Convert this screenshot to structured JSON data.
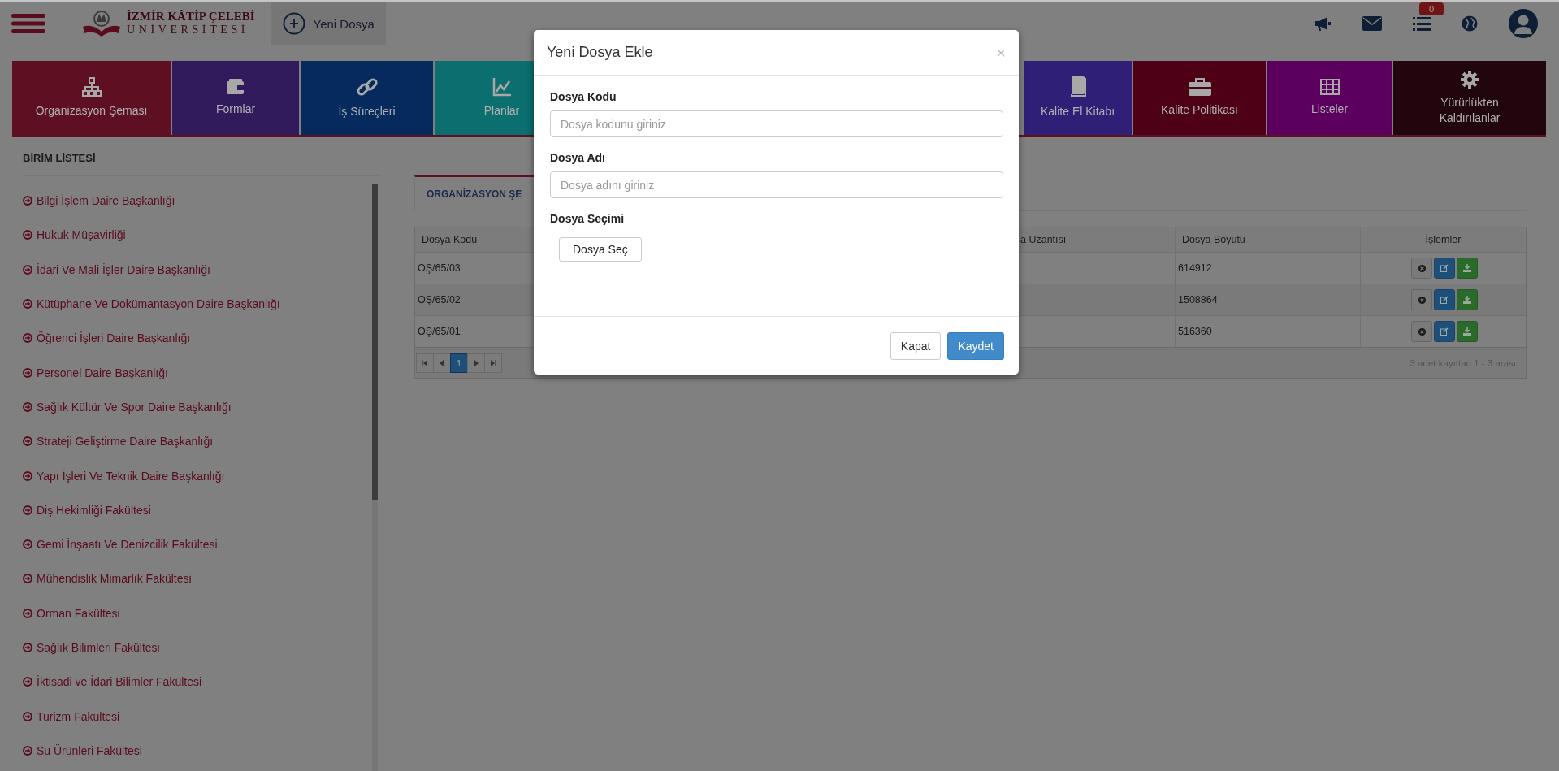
{
  "header": {
    "logo": {
      "line1": "İZMİR KÂTİP ÇELEBİ",
      "line2": "ÜNİVERSİTESİ"
    },
    "new_button": "Yeni Dosya",
    "notification_count": "0"
  },
  "tiles": [
    {
      "label": "Organizasyon Şeması",
      "kind": "hierarchy",
      "color": "#5e0f22"
    },
    {
      "label": "Formlar",
      "kind": "wallet",
      "color": "#311b5c"
    },
    {
      "label": "İş Süreçleri",
      "kind": "link",
      "color": "#072a5e"
    },
    {
      "label": "Planlar",
      "kind": "chart",
      "color": "#0a6f6e"
    },
    {
      "label": "Kalite El Kitabı",
      "kind": "book",
      "color": "#2f1f77"
    },
    {
      "label": "Kalite Politikası",
      "kind": "briefcase",
      "color": "#4d0016"
    },
    {
      "label": "Listeler",
      "kind": "grid",
      "color": "#5c0060"
    },
    {
      "label": "Yürürlükten Kaldırılanlar",
      "kind": "gear",
      "color": "#22060d"
    }
  ],
  "sidebar": {
    "title": "BİRİM LİSTESİ",
    "items": [
      "Bilgi İşlem Daire Başkanlığı",
      "Hukuk Müşavirliği",
      "İdari Ve Mali İşler Daire Başkanlığı",
      "Kütüphane Ve Dokümantasyon Daire Başkanlığı",
      "Öğrenci İşleri Daire Başkanlığı",
      "Personel Daire Başkanlığı",
      "Sağlık Kültür Ve Spor Daire Başkanlığı",
      "Strateji Geliştirme Daire Başkanlığı",
      "Yapı İşleri Ve Teknik Daire Başkanlığı",
      "Diş Hekimliği Fakültesi",
      "Gemi İnşaatı Ve Denizcilik Fakültesi",
      "Mühendislik Mimarlık Fakültesi",
      "Orman Fakültesi",
      "Sağlık Bilimleri Fakültesi",
      "İktisadi ve İdari Bilimler Fakültesi",
      "Turizm Fakültesi",
      "Su Ürünleri Fakültesi"
    ]
  },
  "tab": {
    "label": "ORGANİZASYON ŞE",
    "selected": true
  },
  "table": {
    "columns": [
      "Dosya Kodu",
      "a Uzantısı",
      "Dosya Boyutu",
      "İşlemler"
    ],
    "rows": [
      {
        "code": "OŞ/65/03",
        "size": "614912"
      },
      {
        "code": "OŞ/65/02",
        "size": "1508864"
      },
      {
        "code": "OŞ/65/01",
        "size": "516360"
      }
    ]
  },
  "pagination": {
    "pages": [
      {
        "label": "1",
        "selected": true
      }
    ],
    "summary": "3 adet kayıttan 1 - 3 arası"
  },
  "modal": {
    "title": "Yeni Dosya Ekle",
    "close": "×",
    "fields": [
      {
        "label": "Dosya Kodu",
        "placeholder": "Dosya kodunu giriniz"
      },
      {
        "label": "Dosya Adı",
        "placeholder": "Dosya adını giriniz"
      }
    ],
    "file": {
      "label": "Dosya Seçimi",
      "button": "Dosya Seç"
    },
    "buttons": [
      {
        "label": "Kapat",
        "kind": "default"
      },
      {
        "label": "Kaydet",
        "kind": "primary"
      }
    ]
  }
}
